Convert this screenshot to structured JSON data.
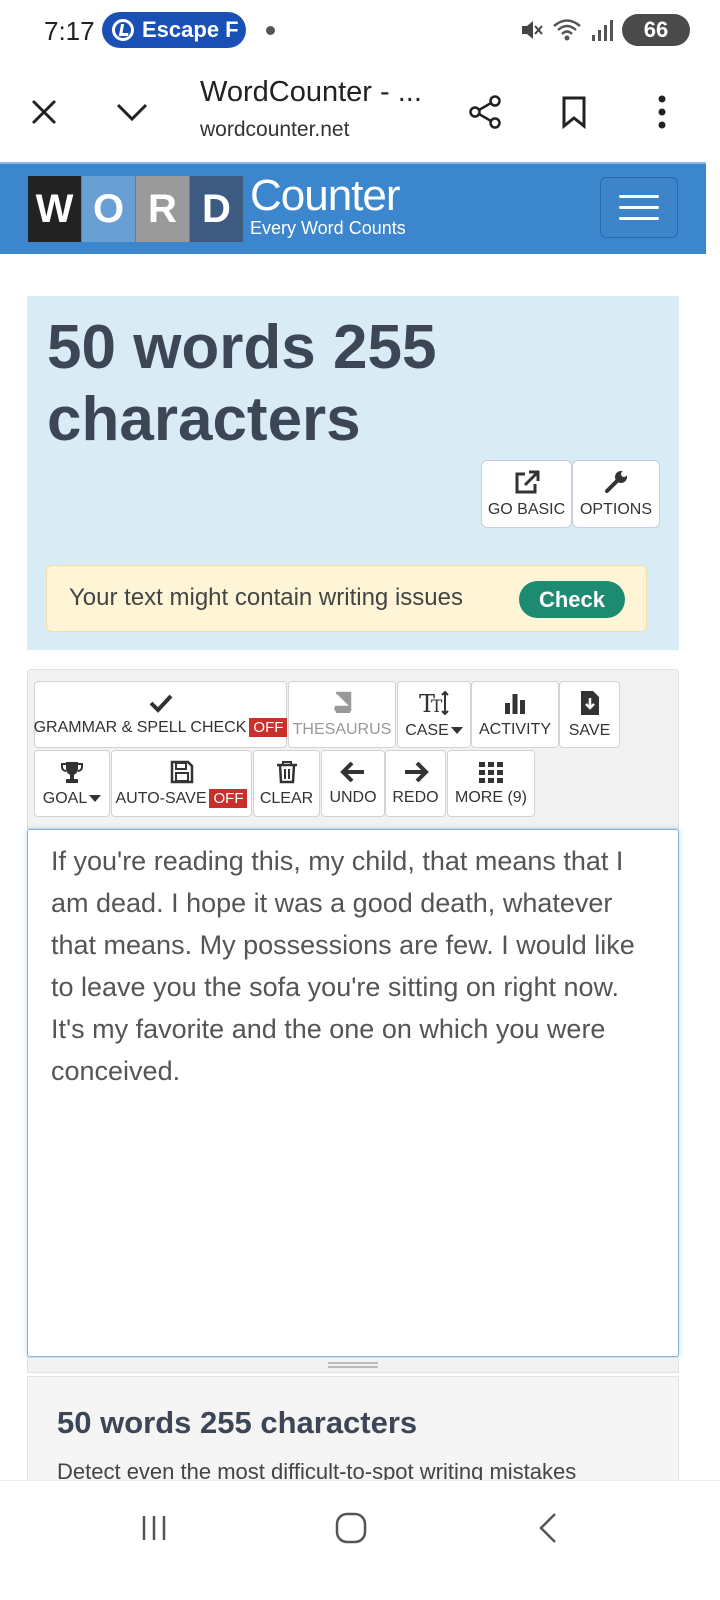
{
  "status_bar": {
    "time": "7:17",
    "notification": "Escape F",
    "battery": "66"
  },
  "browser": {
    "title": "WordCounter - ...",
    "url": "wordcounter.net"
  },
  "site": {
    "logo_letters": [
      "W",
      "O",
      "R",
      "D"
    ],
    "logo_colors": [
      "#222222",
      "#6a9fd4",
      "#9a9a9a",
      "#3d5a80"
    ],
    "logo_counter": "Counter",
    "logo_tagline": "Every Word Counts",
    "header_color": "#3c86cd"
  },
  "stats": {
    "heading": "50 words 255 characters",
    "go_basic_label": "GO BASIC",
    "options_label": "OPTIONS"
  },
  "notice": {
    "text": "Your text might contain writing issues",
    "check_label": "Check"
  },
  "toolbar": {
    "grammar_label": "GRAMMAR & SPELL CHECK",
    "grammar_state": "OFF",
    "thesaurus_label": "THESAURUS",
    "case_label": "CASE",
    "activity_label": "ACTIVITY",
    "save_label": "SAVE",
    "goal_label": "GOAL",
    "autosave_label": "AUTO-SAVE",
    "autosave_state": "OFF",
    "clear_label": "CLEAR",
    "undo_label": "UNDO",
    "redo_label": "REDO",
    "more_label": "MORE (9)"
  },
  "editor": {
    "text": "If you're reading this, my child, that means that I am dead. I hope it was a good death, whatever that means. My possessions are few. I would like to leave you the sofa you're sitting on right now. It's my favorite and the one on which you were conceived."
  },
  "bottom": {
    "heading": "50 words 255 characters",
    "subtext": "Detect even the most difficult-to-spot writing mistakes"
  }
}
